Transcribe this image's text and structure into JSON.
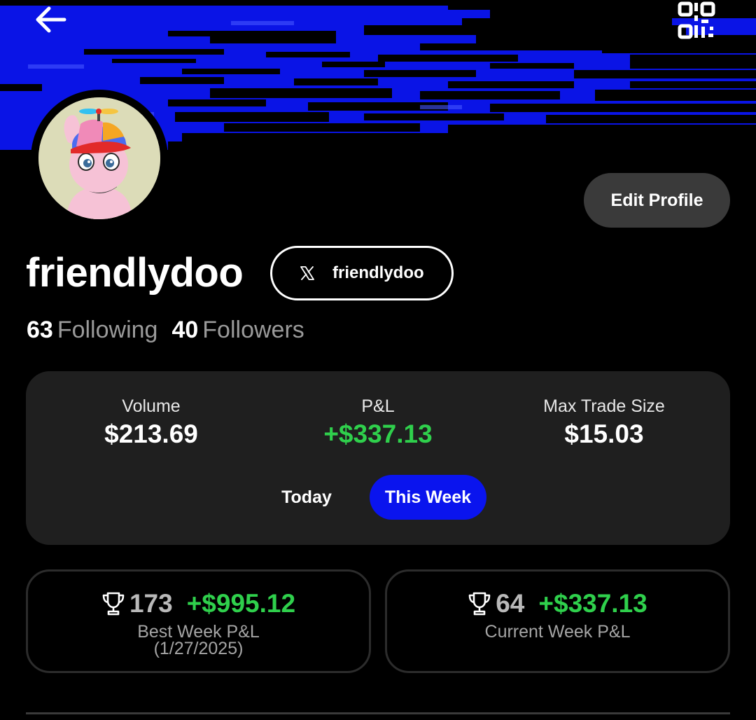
{
  "header": {
    "back_icon": "arrow-left-icon",
    "qr_icon": "qr-code-icon",
    "banner_color": "#0a14e6"
  },
  "profile": {
    "avatar_icon": "avatar-pink-character-propeller-hat",
    "username": "friendlydoo",
    "edit_label": "Edit Profile",
    "x_icon": "x-logo-icon",
    "x_handle": "friendlydoo",
    "following_count": "63",
    "following_label": "Following",
    "followers_count": "40",
    "followers_label": "Followers"
  },
  "stats": {
    "volume_label": "Volume",
    "volume_value": "$213.69",
    "pnl_label": "P&L",
    "pnl_value": "+$337.13",
    "max_label": "Max Trade Size",
    "max_value": "$15.03",
    "tabs": [
      {
        "label": "Today",
        "active": false
      },
      {
        "label": "This Week",
        "active": true
      }
    ],
    "accent": "#0a14ee",
    "positive_color": "#2fd04c"
  },
  "weekly": {
    "best": {
      "rank": "173",
      "value": "+$995.12",
      "label": "Best Week P&L",
      "date": "(1/27/2025)"
    },
    "current": {
      "rank": "64",
      "value": "+$337.13",
      "label": "Current Week P&L"
    },
    "trophy_icon": "trophy-icon"
  }
}
